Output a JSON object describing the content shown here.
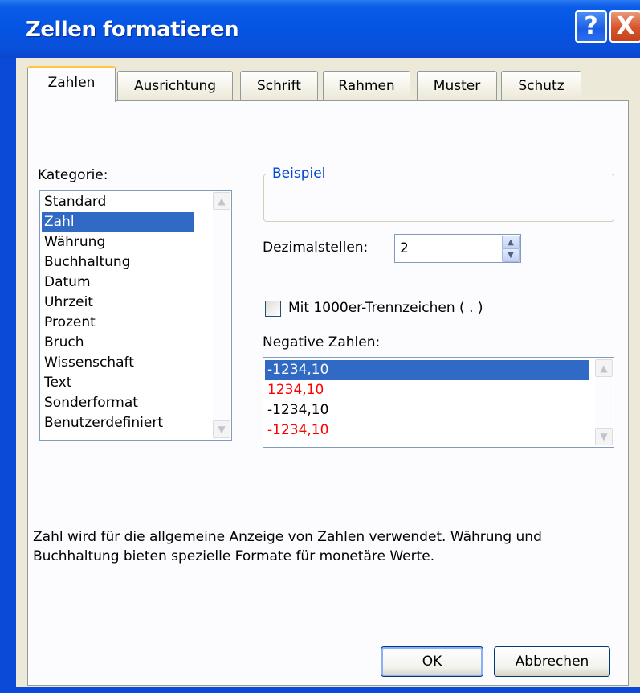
{
  "window": {
    "title": "Zellen formatieren",
    "help_glyph": "?",
    "close_glyph": "X"
  },
  "tabs": [
    {
      "label": "Zahlen",
      "active": true
    },
    {
      "label": "Ausrichtung",
      "active": false
    },
    {
      "label": "Schrift",
      "active": false
    },
    {
      "label": "Rahmen",
      "active": false
    },
    {
      "label": "Muster",
      "active": false
    },
    {
      "label": "Schutz",
      "active": false
    }
  ],
  "category": {
    "label": "Kategorie:",
    "items": [
      "Standard",
      "Zahl",
      "Währung",
      "Buchhaltung",
      "Datum",
      "Uhrzeit",
      "Prozent",
      "Bruch",
      "Wissenschaft",
      "Text",
      "Sonderformat",
      "Benutzerdefiniert"
    ],
    "selected": "Zahl"
  },
  "sample": {
    "label": "Beispiel",
    "value": ""
  },
  "decimals": {
    "label": "Dezimalstellen:",
    "value": "2"
  },
  "thousands": {
    "label": "Mit 1000er-Trennzeichen ( . )",
    "checked": false
  },
  "negative": {
    "label": "Negative Zahlen:",
    "items": [
      {
        "text": "-1234,10",
        "color": "#000000",
        "selected": true
      },
      {
        "text": "1234,10",
        "color": "#ff0000",
        "selected": false
      },
      {
        "text": "-1234,10",
        "color": "#000000",
        "selected": false
      },
      {
        "text": "-1234,10",
        "color": "#ff0000",
        "selected": false
      }
    ]
  },
  "description": "Zahl wird für die allgemeine Anzeige von Zahlen verwendet. Währung und Buchhaltung bieten spezielle Formate für monetäre Werte.",
  "buttons": {
    "ok": "OK",
    "cancel": "Abbrechen"
  },
  "colors": {
    "titlebar": "#0554e3",
    "selection": "#316ac5",
    "group_label": "#0046d5",
    "negative_red": "#ff0000"
  }
}
